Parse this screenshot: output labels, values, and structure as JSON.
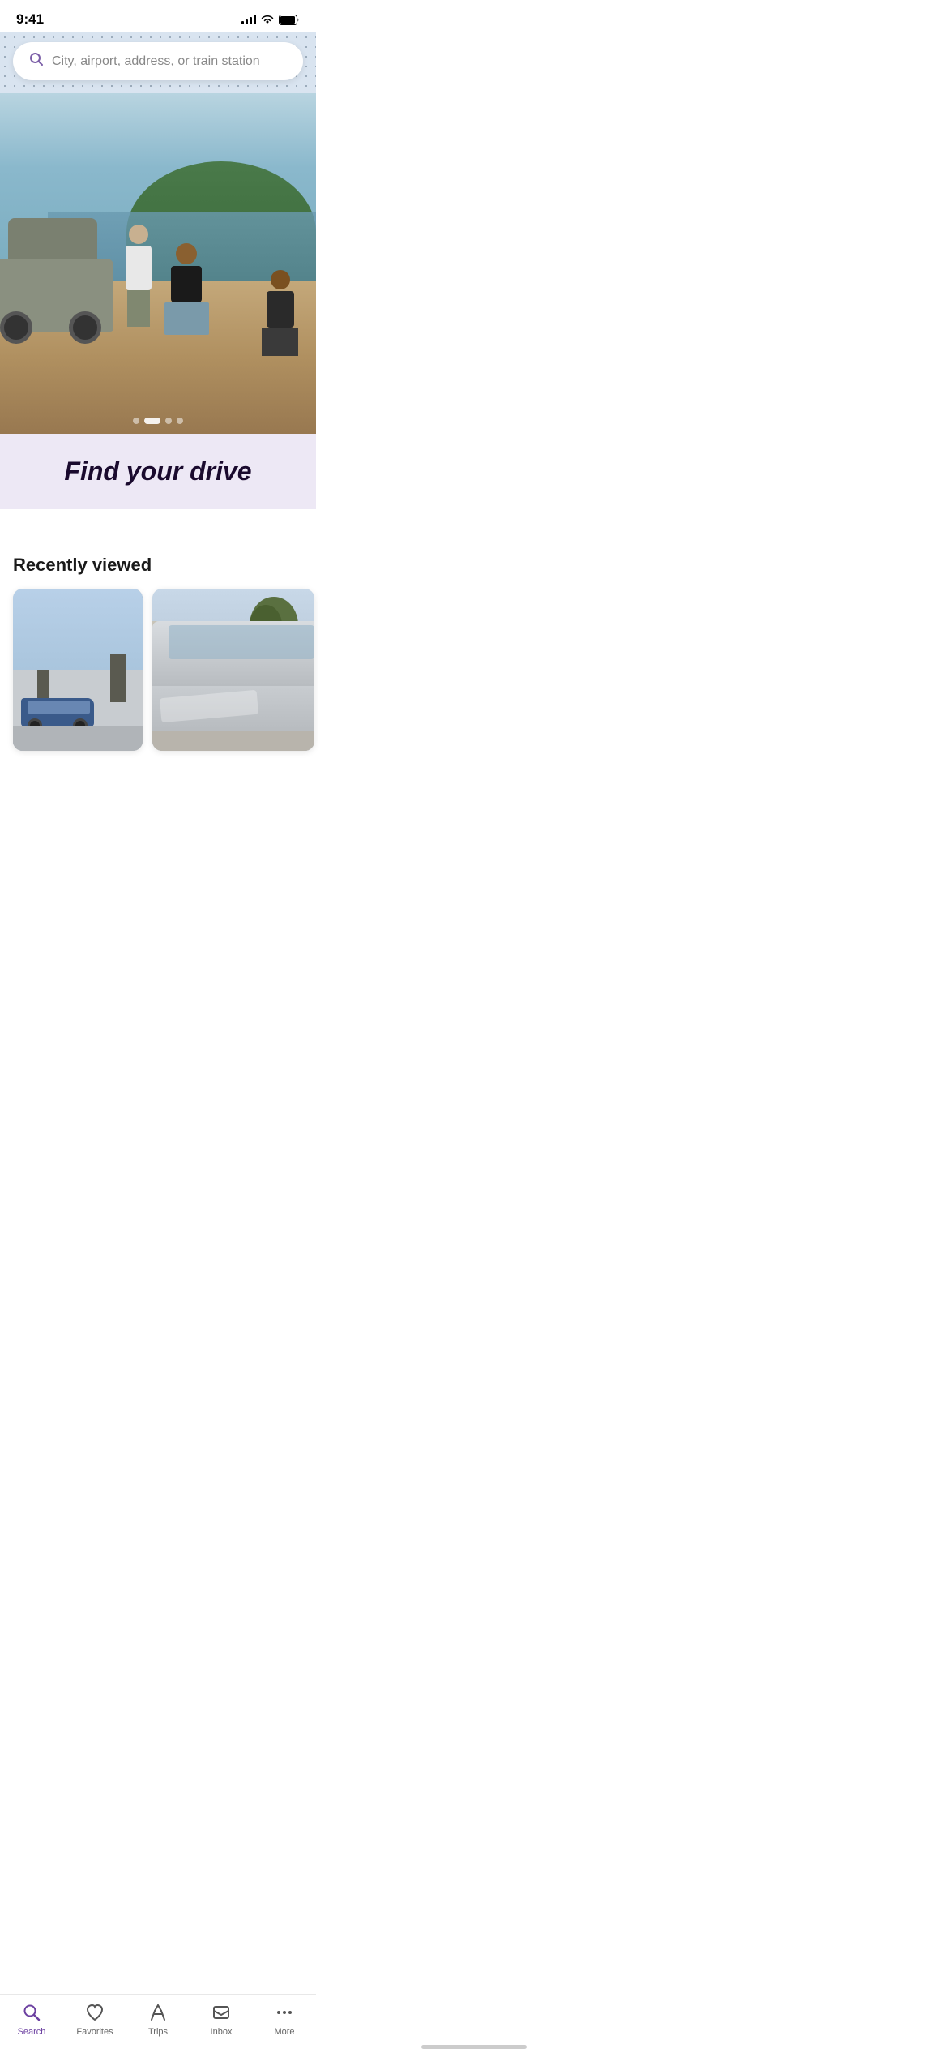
{
  "statusBar": {
    "time": "9:41",
    "signalBars": 4,
    "wifiOn": true,
    "batteryFull": true
  },
  "searchBar": {
    "placeholder": "City, airport, address, or train station",
    "iconName": "search-icon"
  },
  "hero": {
    "altText": "Group of friends at a beach next to a Jeep",
    "carouselDots": [
      false,
      true,
      false,
      false
    ]
  },
  "findDriveBanner": {
    "text": "Find your drive"
  },
  "recentlyViewed": {
    "sectionTitle": "Recently viewed",
    "cards": [
      {
        "id": "card-1",
        "altText": "Blue sedan parked on residential street"
      },
      {
        "id": "card-2",
        "altText": "Silver car parked in driveway"
      }
    ]
  },
  "tabBar": {
    "items": [
      {
        "id": "search",
        "label": "Search",
        "active": true,
        "iconName": "search-tab-icon"
      },
      {
        "id": "favorites",
        "label": "Favorites",
        "active": false,
        "iconName": "heart-icon"
      },
      {
        "id": "trips",
        "label": "Trips",
        "active": false,
        "iconName": "trips-icon"
      },
      {
        "id": "inbox",
        "label": "Inbox",
        "active": false,
        "iconName": "inbox-icon"
      },
      {
        "id": "more",
        "label": "More",
        "active": false,
        "iconName": "more-icon"
      }
    ]
  }
}
